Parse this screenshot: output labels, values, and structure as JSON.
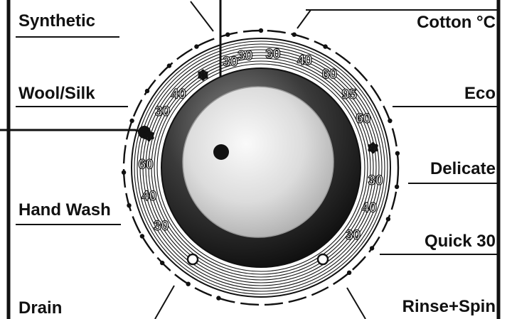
{
  "programs": {
    "left": [
      {
        "label": "Synthetic"
      },
      {
        "label": "Wool/Silk"
      },
      {
        "label": "Hand Wash"
      },
      {
        "label": "Drain"
      }
    ],
    "right": [
      {
        "label": "Cotton °C"
      },
      {
        "label": "Eco"
      },
      {
        "label": "Delicate"
      },
      {
        "label": "Quick 30"
      },
      {
        "label": "Rinse+Spin"
      }
    ]
  },
  "temperatures": [
    "30",
    "40",
    "60",
    "❄",
    "30",
    "40",
    "❄",
    "30",
    "30",
    "30",
    "40",
    "60",
    "95",
    "60",
    "❄",
    "30",
    "40",
    "30"
  ],
  "colors": {
    "ink": "#111111",
    "knob_highlight": "#f2f2f2",
    "knob_shadow": "#1a1a1a",
    "ring": "#111111"
  }
}
